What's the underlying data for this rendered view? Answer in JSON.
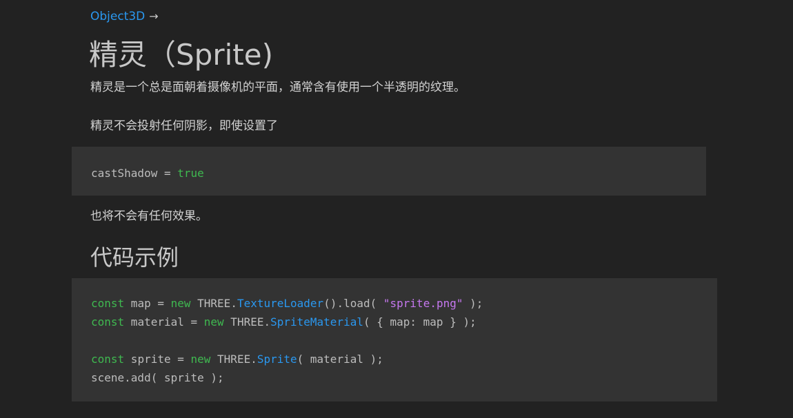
{
  "breadcrumb": {
    "parent_link": "Object3D",
    "arrow": "→"
  },
  "page": {
    "title": "精灵（Sprite)",
    "paragraph_1": "精灵是一个总是面朝着摄像机的平面，通常含有使用一个半透明的纹理。",
    "paragraph_2": "精灵不会投射任何阴影，即使设置了",
    "paragraph_3": "也将不会有任何效果。"
  },
  "inline_code": {
    "prop": "castShadow",
    "op": " = ",
    "value": "true"
  },
  "example": {
    "heading": "代码示例",
    "line1": {
      "kw": "const",
      "a": " map = ",
      "new": "new",
      "b": " THREE.",
      "cls": "TextureLoader",
      "c": "().load( ",
      "str": "\"sprite.png\"",
      "d": " );"
    },
    "line2": {
      "kw": "const",
      "a": " material = ",
      "new": "new",
      "b": " THREE.",
      "cls": "SpriteMaterial",
      "c": "( { map: map } );"
    },
    "line4": {
      "kw": "const",
      "a": " sprite = ",
      "new": "new",
      "b": " THREE.",
      "cls": "Sprite",
      "c": "( material );"
    },
    "line5": {
      "text": "scene.add( sprite );"
    }
  },
  "colors": {
    "background": "#222222",
    "code_background": "#333333",
    "link": "#2a98f0",
    "keyword": "#3fb950",
    "string": "#c678f0",
    "class_name": "#2a98f0"
  }
}
